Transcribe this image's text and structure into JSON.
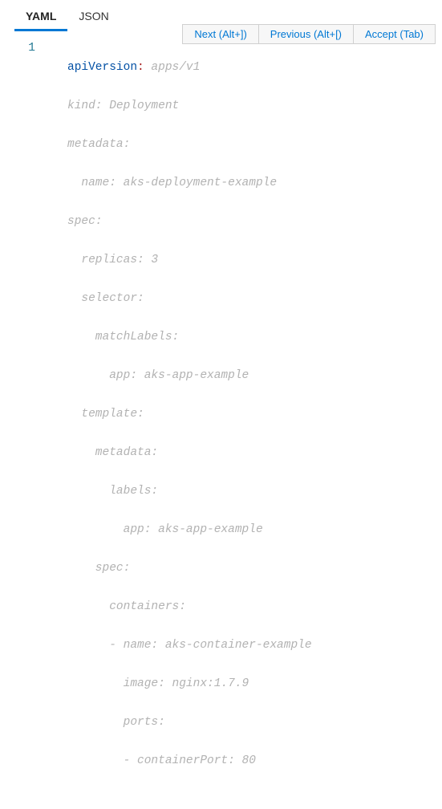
{
  "tabs": {
    "yaml": "YAML",
    "json": "JSON"
  },
  "suggest": {
    "next": "Next (Alt+])",
    "prev": "Previous (Alt+[)",
    "accept": "Accept (Tab)"
  },
  "gutter": {
    "line1": "1"
  },
  "code": {
    "l1_key": "apiVersion",
    "l1_colon": ":",
    "l1_val": " apps/v1",
    "l2": "kind: Deployment",
    "l3": "metadata:",
    "l4": "  name: aks-deployment-example",
    "l5": "spec:",
    "l6": "  replicas: 3",
    "l7": "  selector:",
    "l8": "    matchLabels:",
    "l9": "      app: aks-app-example",
    "l10": "  template:",
    "l11": "    metadata:",
    "l12": "      labels:",
    "l13": "        app: aks-app-example",
    "l14": "    spec:",
    "l15": "      containers:",
    "l16": "      - name: aks-container-example",
    "l17": "        image: nginx:1.7.9",
    "l18": "        ports:",
    "l19": "        - containerPort: 80"
  }
}
